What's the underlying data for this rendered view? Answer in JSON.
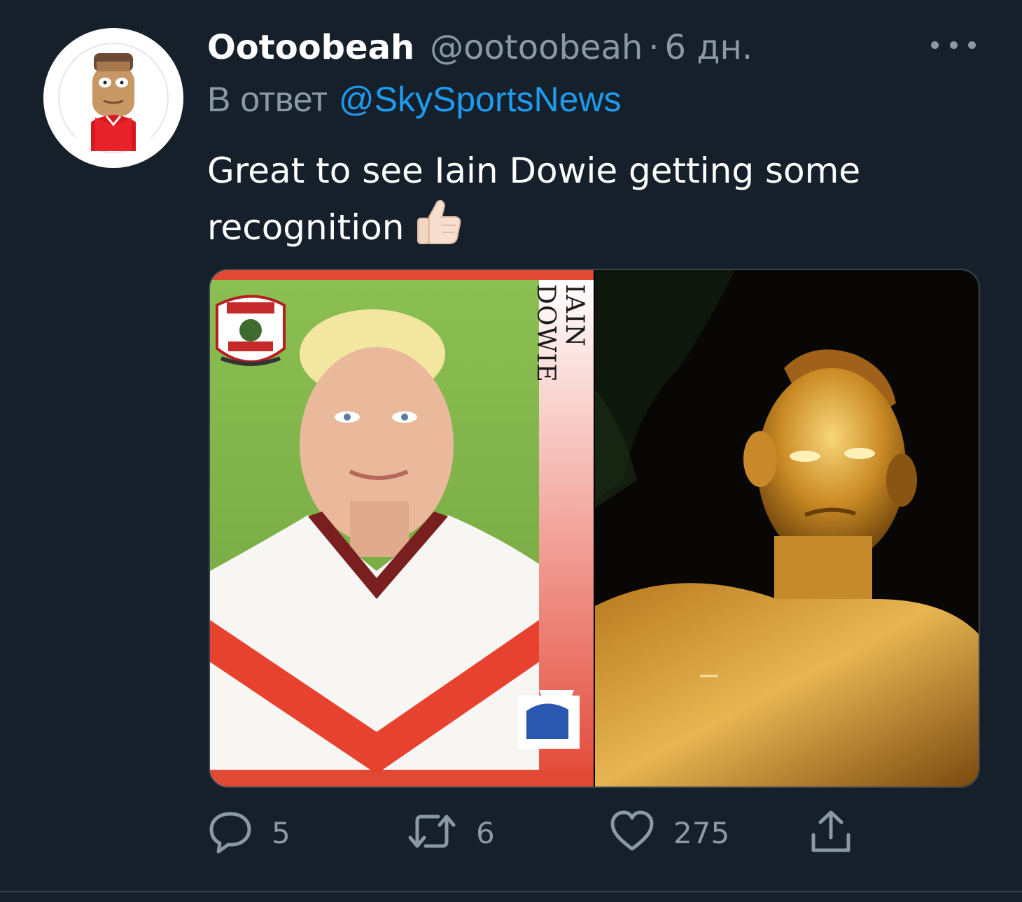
{
  "tweet": {
    "display_name": "Ootoobeah",
    "handle": "@ootoobeah",
    "separator": "·",
    "time": "6 дн.",
    "reply_prefix": "В ответ",
    "reply_to": "@SkySportsNews",
    "text": "Great to see Iain Dowie getting some recognition",
    "media": {
      "card_name": "IAIN DOWIE"
    },
    "actions": {
      "replies": "5",
      "retweets": "6",
      "likes": "275"
    }
  },
  "icons": {
    "more": "more-horizontal-icon",
    "reply": "reply-icon",
    "retweet": "retweet-icon",
    "like": "heart-icon",
    "share": "share-icon",
    "emoji": "thumbs-up-emoji"
  },
  "colors": {
    "background": "#15202b",
    "primary_text": "#ffffff",
    "secondary_text": "#8b98a5",
    "link": "#1d9bf0",
    "border": "#38444d"
  }
}
